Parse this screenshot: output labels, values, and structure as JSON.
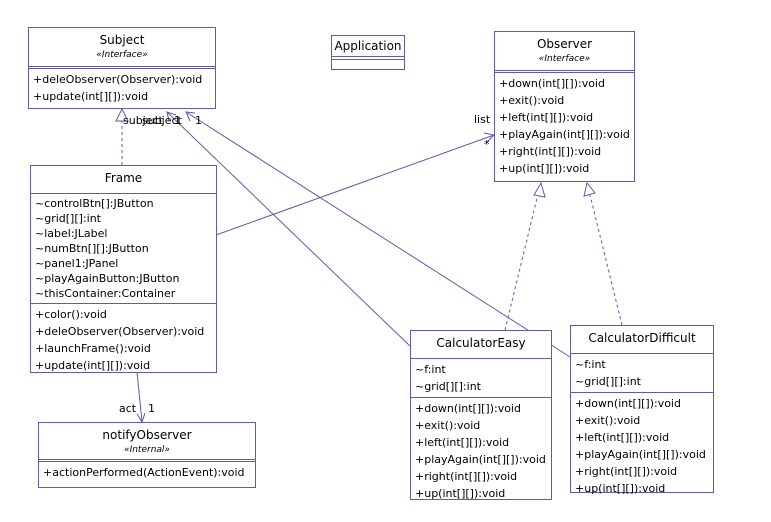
{
  "classes": {
    "subject": {
      "name": "Subject",
      "stereotype": "«Interface»",
      "methods": [
        "+deleObserver(Observer):void",
        "+update(int[][]):void"
      ]
    },
    "application": {
      "name": "Application"
    },
    "observer": {
      "name": "Observer",
      "stereotype": "«Interface»",
      "methods": [
        "+down(int[][]):void",
        "+exit():void",
        "+left(int[][]):void",
        "+playAgain(int[][]):void",
        "+right(int[][]):void",
        "+up(int[][]):void"
      ]
    },
    "frame": {
      "name": "Frame",
      "attributes": [
        "~controlBtn[]:JButton",
        "~grid[][]:int",
        "~label:JLabel",
        "~numBtn[][]:JButton",
        "~panel1:JPanel",
        "~playAgainButton:JButton",
        "~thisContainer:Container"
      ],
      "methods": [
        "+color():void",
        "+deleObserver(Observer):void",
        "+launchFrame():void",
        "+update(int[][]):void"
      ]
    },
    "notifyObserver": {
      "name": "notifyObserver",
      "stereotype": "«Internal»",
      "methods": [
        "+actionPerformed(ActionEvent):void"
      ]
    },
    "calculatorEasy": {
      "name": "CalculatorEasy",
      "attributes": [
        "~f:int",
        "~grid[][]:int"
      ],
      "methods": [
        "+down(int[][]):void",
        "+exit():void",
        "+left(int[][]):void",
        "+playAgain(int[][]):void",
        "+right(int[][]):void",
        "+up(int[][]):void"
      ]
    },
    "calculatorDifficult": {
      "name": "CalculatorDifficult",
      "attributes": [
        "~f:int",
        "~grid[][]:int"
      ],
      "methods": [
        "+down(int[][]):void",
        "+exit():void",
        "+left(int[][]):void",
        "+playAgain(int[][]):void",
        "+right(int[][]):void",
        "+up(int[][]):void"
      ]
    }
  },
  "labels": {
    "subject1": "subject",
    "subject2": "subject",
    "one1": "1",
    "one2": "1",
    "list": "list",
    "star": "*",
    "act": "act",
    "actOne": "1"
  },
  "colors": {
    "line": "#5b5bb0"
  }
}
